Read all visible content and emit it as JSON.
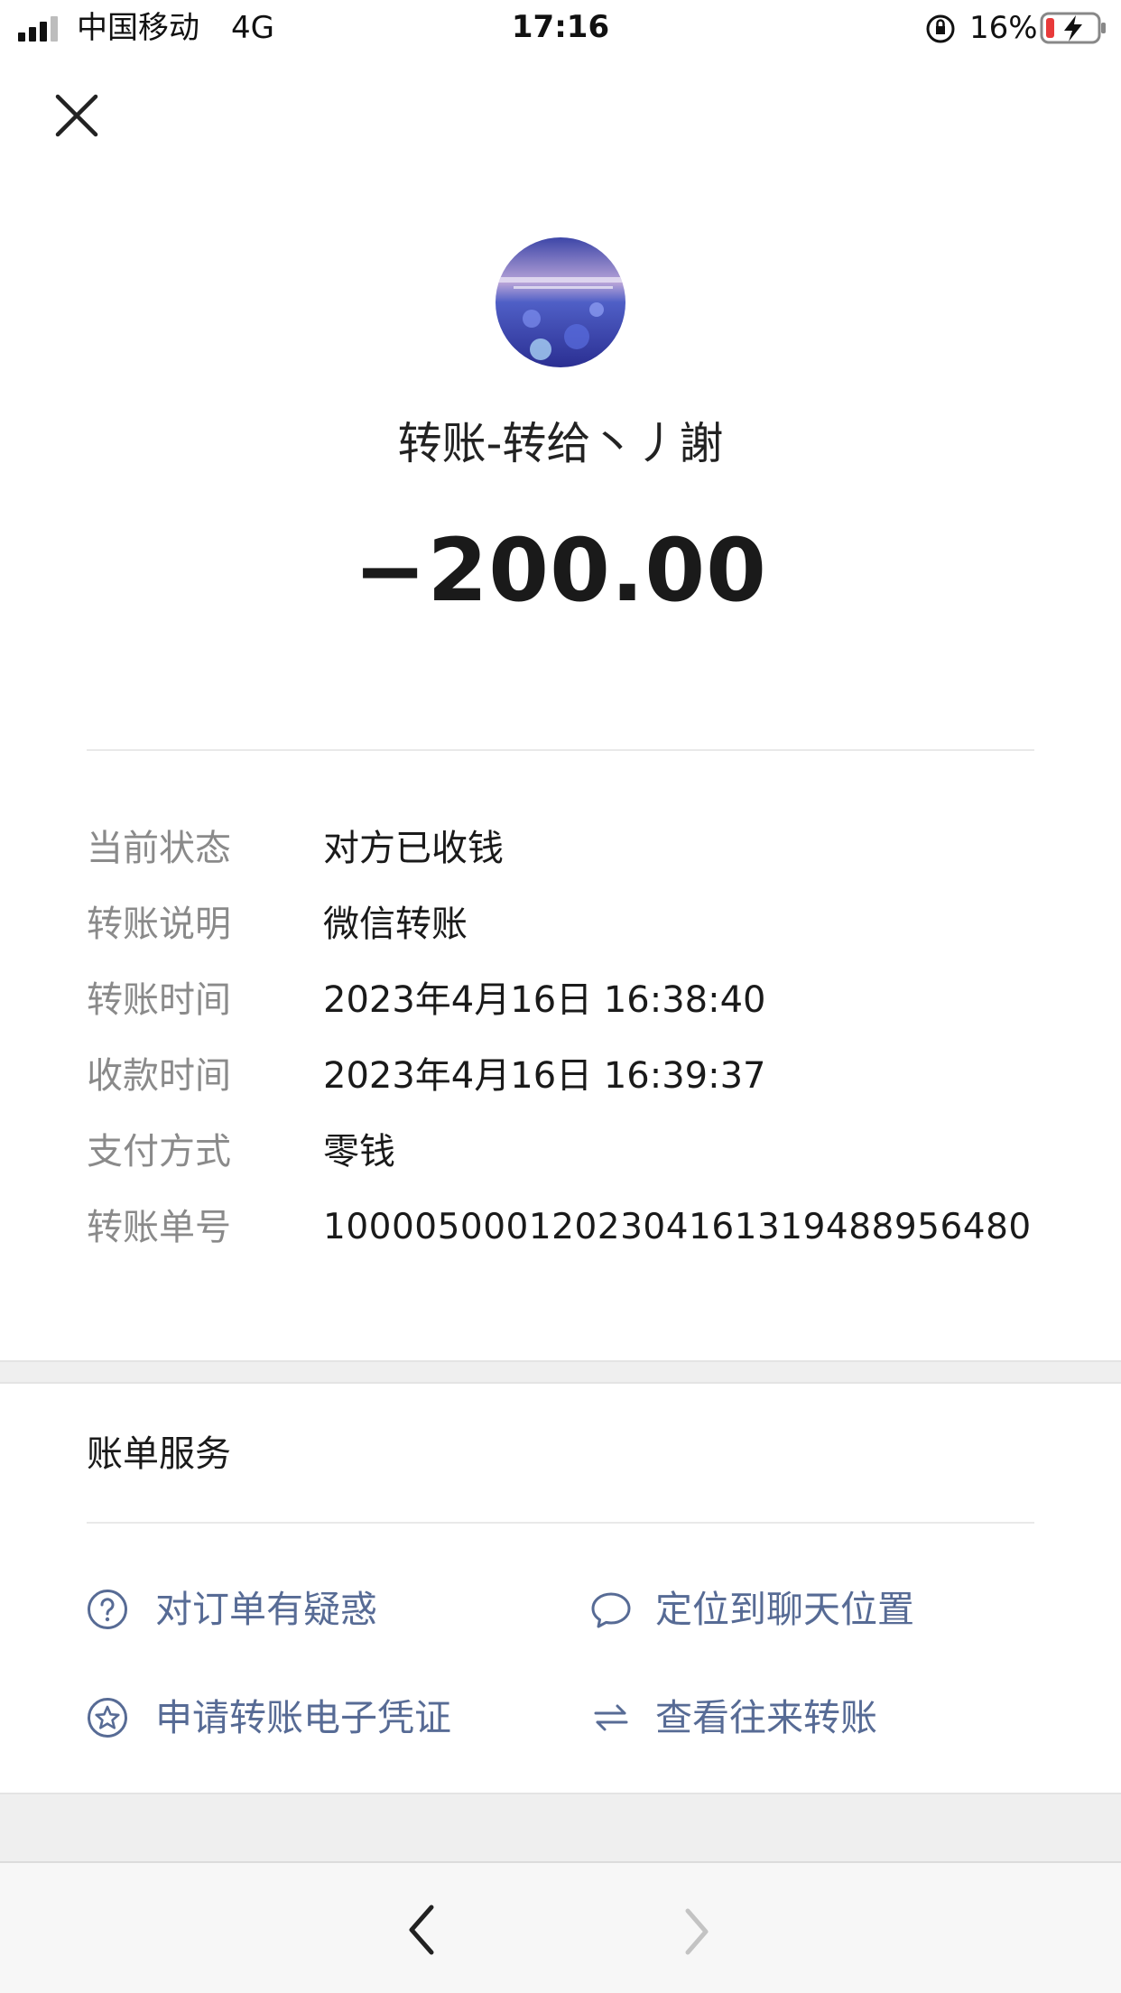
{
  "status_bar": {
    "carrier": "中国移动",
    "network": "4G",
    "time": "17:16",
    "battery": "16%"
  },
  "header": {
    "close_icon": "close-icon",
    "title": "转账-转给丶丿謝",
    "amount": "−200.00"
  },
  "details": [
    {
      "label": "当前状态",
      "value": "对方已收钱"
    },
    {
      "label": "转账说明",
      "value": "微信转账"
    },
    {
      "label": "转账时间",
      "value": "2023年4月16日 16:38:40"
    },
    {
      "label": "收款时间",
      "value": "2023年4月16日 16:39:37"
    },
    {
      "label": "支付方式",
      "value": "零钱"
    },
    {
      "label": "转账单号",
      "value": "100005000120230416131948895648​0"
    }
  ],
  "services": {
    "title": "账单服务",
    "items": [
      {
        "label": "对订单有疑惑",
        "icon": "question-circle-icon"
      },
      {
        "label": "定位到聊天位置",
        "icon": "chat-bubble-icon"
      },
      {
        "label": "申请转账电子凭证",
        "icon": "star-circle-icon"
      },
      {
        "label": "查看往来转账",
        "icon": "exchange-arrows-icon"
      }
    ]
  },
  "colors": {
    "link": "#576b95",
    "label_gray": "#8a8a8a",
    "battery_low": "#e83a3a",
    "background_gray": "#efefef"
  }
}
